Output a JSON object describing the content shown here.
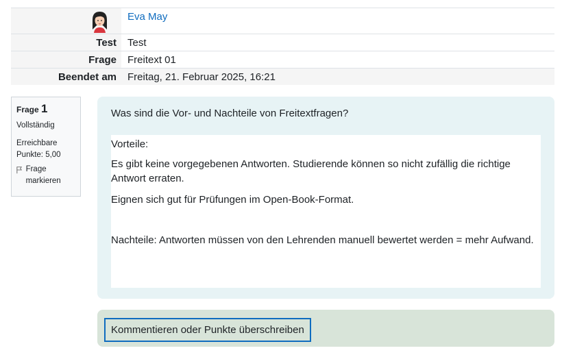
{
  "summary": {
    "user": {
      "name": "Eva May",
      "avatar_icon": "user-avatar-icon"
    },
    "rows": [
      {
        "label": "Test",
        "value": "Test"
      },
      {
        "label": "Frage",
        "value": "Freitext 01"
      },
      {
        "label": "Beendet am",
        "value": "Freitag, 21. Februar 2025, 16:21"
      }
    ]
  },
  "question_info": {
    "question_label": "Frage",
    "question_number": "1",
    "state": "Vollständig",
    "grade": "Erreichbare Punkte: 5,00",
    "flag_label": "Frage markieren",
    "flag_icon": "flag-icon"
  },
  "question": {
    "text": "Was sind die Vor- und Nachteile von Freitextfragen?",
    "answer": [
      "Vorteile:",
      "Es gibt keine vorgegebenen Antworten. Studierende können so nicht zufällig die richtige Antwort erraten.",
      "Eignen sich gut für Prüfungen im Open-Book-Format.",
      "Nachteile: Antworten müssen von den Lehrenden manuell bewertet werden = mehr Aufwand."
    ]
  },
  "comment": {
    "button_label": "Kommentieren oder Punkte überschreiben"
  },
  "colors": {
    "link": "#0f6cbf",
    "content_bg": "#e7f3f5",
    "comment_bg": "#d8e4d9",
    "label_bg": "#f5f5f5"
  }
}
